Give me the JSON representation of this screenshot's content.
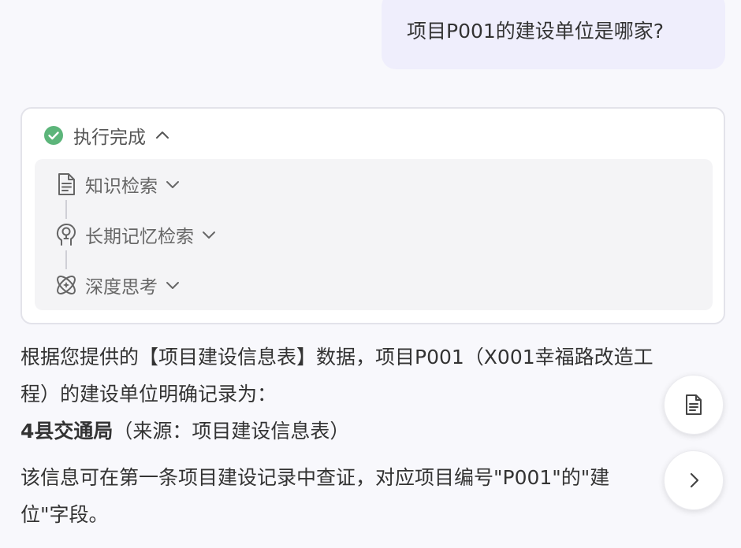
{
  "user_message": {
    "text": "项目P001的建设单位是哪家?"
  },
  "execution": {
    "status_label": "执行完成",
    "status_icon": "check-circle-icon",
    "accent_color": "#5cb57a",
    "steps": [
      {
        "label": "知识检索",
        "icon": "document-icon"
      },
      {
        "label": "长期记忆检索",
        "icon": "brain-head-icon"
      },
      {
        "label": "深度思考",
        "icon": "atom-icon"
      }
    ]
  },
  "answer": {
    "line1": "根据您提供的【项目建设信息表】数据，项目P001（X001幸福路改造工",
    "line2": "程）的建设单位明确记录为：",
    "unit_name": "4县交通局",
    "unit_source": "（来源：项目建设信息表）",
    "line4": "该信息可在第一条项目建设记录中查证，对应项目编号\"P001\"的\"建",
    "line5": "位\"字段。"
  },
  "floating_buttons": [
    {
      "icon": "document-icon"
    },
    {
      "icon": "chevron-right-icon"
    }
  ]
}
